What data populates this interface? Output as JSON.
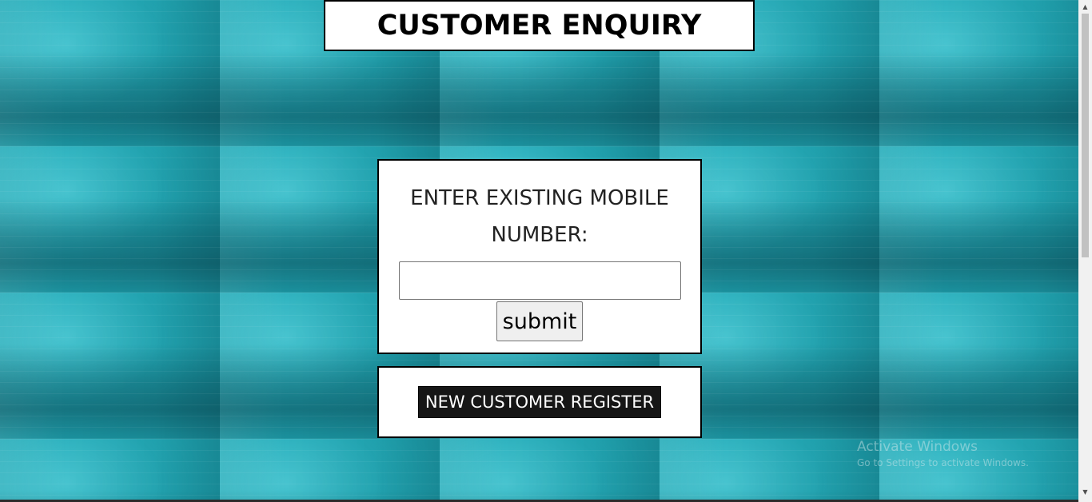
{
  "header": {
    "title": "CUSTOMER ENQUIRY"
  },
  "enquiry": {
    "label": "ENTER EXISTING MOBILE NUMBER:",
    "mobile_value": "",
    "mobile_placeholder": "",
    "submit_label": "submit"
  },
  "register": {
    "button_label": "NEW CUSTOMER REGISTER"
  },
  "watermark": {
    "title": "Activate Windows",
    "subtitle": "Go to Settings to activate Windows."
  },
  "icons": {
    "scroll_up": "chevron-up-icon",
    "scroll_down": "chevron-down-icon"
  },
  "colors": {
    "background": "#1fa7b4",
    "panel": "#ffffff",
    "register_button": "#161616"
  }
}
